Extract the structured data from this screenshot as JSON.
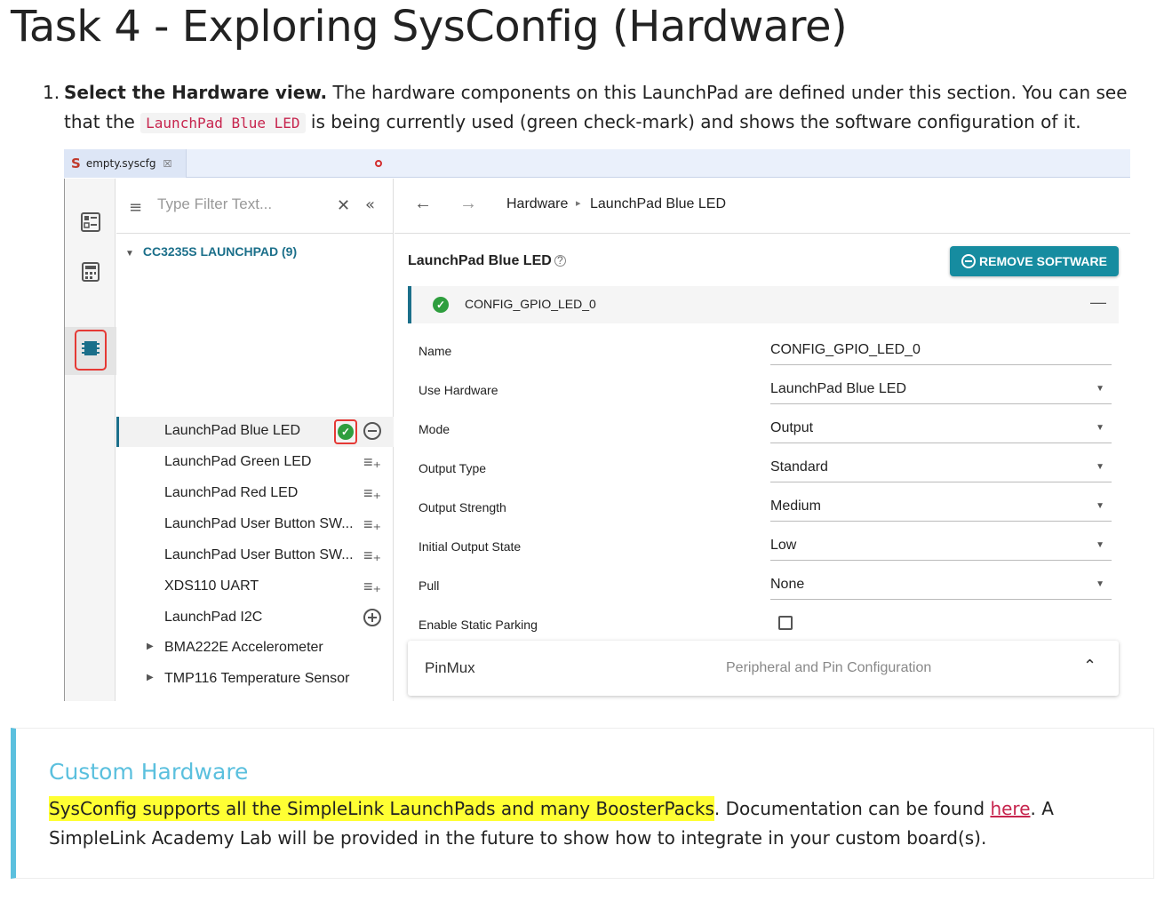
{
  "page": {
    "title": "Task 4 - Exploring SysConfig (Hardware)",
    "step_number": "1.",
    "step_bold": "Select the Hardware view.",
    "step_text_1": " The hardware components on this LaunchPad are defined under this section. You can see that the ",
    "step_code": "LaunchPad Blue LED",
    "step_text_2": " is being currently used (green check-mark) and shows the software configuration of it."
  },
  "screenshot": {
    "tab": {
      "logo": "S",
      "label": "empty.syscfg",
      "close": "☒"
    },
    "filter": {
      "placeholder": "Type Filter Text...",
      "clear": "✕",
      "collapse": "«"
    },
    "tree": {
      "root_label": "CC3235S LAUNCHPAD (9)",
      "items": [
        {
          "label": "LaunchPad Blue LED",
          "state": "used"
        },
        {
          "label": "LaunchPad Green LED",
          "state": "add"
        },
        {
          "label": "LaunchPad Red LED",
          "state": "add"
        },
        {
          "label": "LaunchPad User Button SW...",
          "state": "add"
        },
        {
          "label": "LaunchPad User Button SW...",
          "state": "add"
        },
        {
          "label": "XDS110 UART",
          "state": "add"
        },
        {
          "label": "LaunchPad I2C",
          "state": "add-circle"
        }
      ],
      "groups": [
        {
          "label": "BMA222E Accelerometer"
        },
        {
          "label": "TMP116 Temperature Sensor"
        }
      ]
    },
    "breadcrumb": {
      "back": "←",
      "forward": "→",
      "root": "Hardware",
      "sep": "▸",
      "current": "LaunchPad Blue LED"
    },
    "module": {
      "title": "LaunchPad Blue LED",
      "help": "?",
      "remove_button": "REMOVE SOFTWARE",
      "instance": "CONFIG_GPIO_LED_0",
      "collapse": "—"
    },
    "config": [
      {
        "key": "Name",
        "value": "CONFIG_GPIO_LED_0",
        "dropdown": false
      },
      {
        "key": "Use Hardware",
        "value": "LaunchPad Blue LED",
        "dropdown": true
      },
      {
        "key": "Mode",
        "value": "Output",
        "dropdown": true
      },
      {
        "key": "Output Type",
        "value": "Standard",
        "dropdown": true
      },
      {
        "key": "Output Strength",
        "value": "Medium",
        "dropdown": true
      },
      {
        "key": "Initial Output State",
        "value": "Low",
        "dropdown": true
      },
      {
        "key": "Pull",
        "value": "None",
        "dropdown": true
      }
    ],
    "static_parking_label": "Enable Static Parking",
    "pinmux": {
      "title": "PinMux",
      "desc": "Peripheral and Pin Configuration",
      "chevron": "⌃"
    }
  },
  "callout": {
    "title": "Custom Hardware",
    "highlight": "SysConfig supports all the SimpleLink LaunchPads and many BoosterPacks",
    "text_1": ". Documentation can be found ",
    "link": "here",
    "text_2": ". A SimpleLink Academy Lab will be provided in the future to show how to integrate in your custom board(s)."
  },
  "colors": {
    "accent": "#168ca0",
    "check": "#2e9e3e",
    "highlight": "#ffff33",
    "callout": "#5bc0de",
    "red_box": "#e53935"
  }
}
